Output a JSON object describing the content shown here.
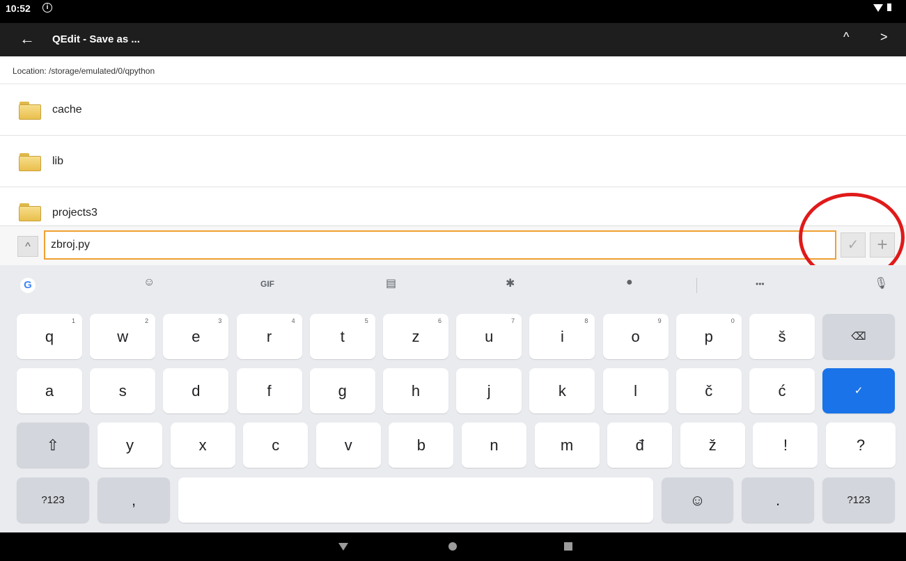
{
  "status_bar": {
    "time": "10:52",
    "info_glyph": "i",
    "wifi_icon": "wifi-icon",
    "battery_icon": "battery-icon"
  },
  "app_bar": {
    "back_glyph": "←",
    "title": "QEdit - Save as ...",
    "up_glyph": "^",
    "next_glyph": ">"
  },
  "location": "Location: /storage/emulated/0/qpython",
  "files": [
    {
      "name": "cache",
      "icon": "folder-icon"
    },
    {
      "name": "lib",
      "icon": "folder-icon"
    },
    {
      "name": "projects3",
      "icon": "folder-icon"
    }
  ],
  "input": {
    "value": "zbroj.py",
    "expand_glyph": "^",
    "ok_glyph": "✓",
    "add_glyph": "+"
  },
  "annotation": {
    "color": "#e01a1a"
  },
  "keyboard": {
    "toolbar": {
      "g": "G",
      "sticker": "☺",
      "gif": "GIF",
      "clipboard": "▤",
      "settings": "✱",
      "palette": "●",
      "more": "•••",
      "mic": "🎙"
    },
    "row1": [
      {
        "label": "q",
        "hint": "1"
      },
      {
        "label": "w",
        "hint": "2"
      },
      {
        "label": "e",
        "hint": "3"
      },
      {
        "label": "r",
        "hint": "4"
      },
      {
        "label": "t",
        "hint": "5"
      },
      {
        "label": "z",
        "hint": "6"
      },
      {
        "label": "u",
        "hint": "7"
      },
      {
        "label": "i",
        "hint": "8"
      },
      {
        "label": "o",
        "hint": "9"
      },
      {
        "label": "p",
        "hint": "0"
      },
      {
        "label": "š",
        "hint": ""
      }
    ],
    "backspace": "⌫",
    "row2": [
      "a",
      "s",
      "d",
      "f",
      "g",
      "h",
      "j",
      "k",
      "l",
      "č",
      "ć"
    ],
    "enter": "✓",
    "shift": "⇧",
    "row3": [
      "y",
      "x",
      "c",
      "v",
      "b",
      "n",
      "m",
      "đ",
      "ž",
      "!",
      "?"
    ],
    "symbols_left": "?123",
    "comma": ",",
    "space": "",
    "emoji": "☺",
    "period": ".",
    "symbols_right": "?123",
    "accent_color": "#1a73e8"
  },
  "nav_bar": {
    "back": "back-triangle-icon",
    "home": "home-circle-icon",
    "recent": "recent-square-icon"
  }
}
